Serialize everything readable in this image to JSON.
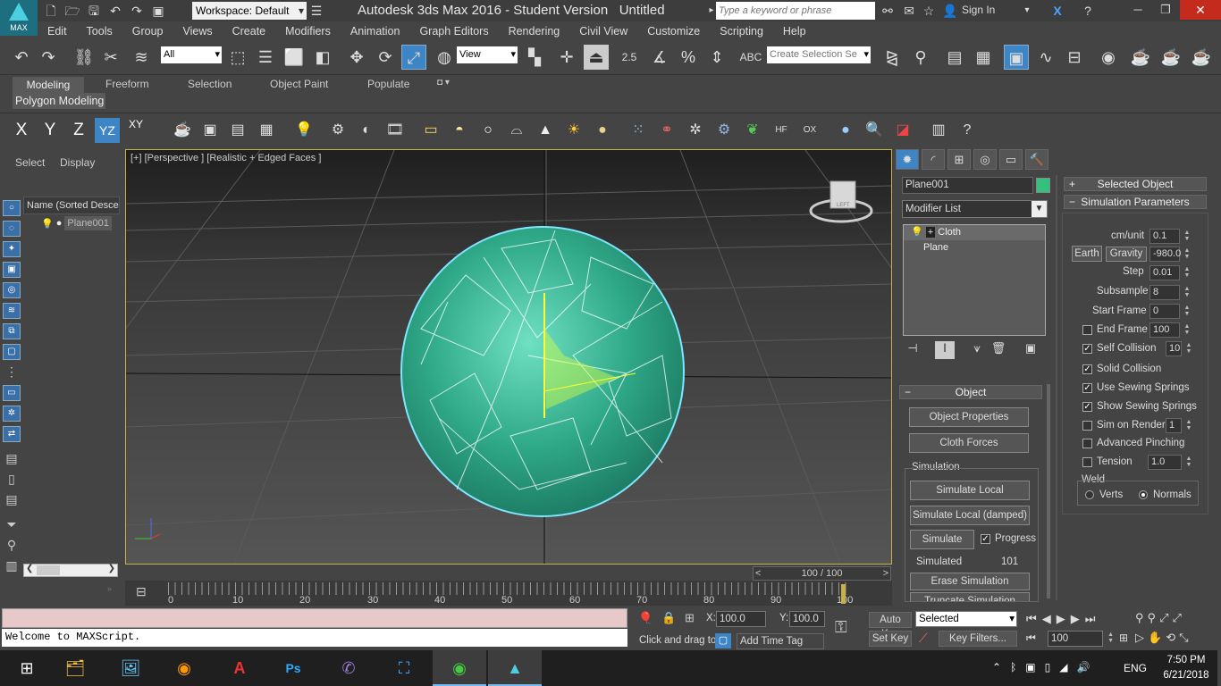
{
  "title_bar": {
    "logo_label": "MAX",
    "workspace": "Workspace: Default",
    "app_title": "Autodesk 3ds Max 2016 - Student Version",
    "doc_title": "Untitled",
    "search_placeholder": "Type a keyword or phrase",
    "sign_in": "Sign In"
  },
  "menu": [
    "Edit",
    "Tools",
    "Group",
    "Views",
    "Create",
    "Modifiers",
    "Animation",
    "Graph Editors",
    "Rendering",
    "Civil View",
    "Customize",
    "Scripting",
    "Help"
  ],
  "toolbar": {
    "filter": "All",
    "ref_coord": "View",
    "snap_value": "2.5",
    "selection_set_placeholder": "Create Selection Se"
  },
  "ribbon": {
    "tabs": [
      "Modeling",
      "Freeform",
      "Selection",
      "Object Paint",
      "Populate"
    ],
    "panel": "Polygon Modeling"
  },
  "axis": {
    "x": "X",
    "y": "Y",
    "z": "Z",
    "yz": "YZ",
    "xy": "XY"
  },
  "scene_explorer": {
    "tabs": [
      "Select",
      "Display"
    ],
    "column_header": "Name (Sorted Descen",
    "items": [
      "Plane001"
    ]
  },
  "viewport": {
    "label": "[+] [Perspective ] [Realistic + Edged Faces ]",
    "viewcube_face": "LEFT"
  },
  "timeline": {
    "frame_indicator": "100 / 100",
    "tick_labels": [
      "0",
      "10",
      "20",
      "30",
      "40",
      "50",
      "60",
      "70",
      "80",
      "90",
      "100"
    ]
  },
  "command_panel": {
    "object_name": "Plane001",
    "object_color": "#34c17e",
    "modifier_list": "Modifier List",
    "stack": [
      "Cloth",
      "Plane"
    ],
    "object_rollout": {
      "title": "Object",
      "buttons": [
        "Object Properties",
        "Cloth Forces"
      ],
      "simulation_group": "Simulation",
      "sim_local": "Simulate Local",
      "sim_local_damped": "Simulate Local (damped)",
      "simulate": "Simulate",
      "progress": "Progress",
      "simulated_label": "Simulated",
      "simulated_value": "101",
      "erase": "Erase Simulation",
      "truncate": "Truncate Simulation"
    },
    "selected_object": "Selected Object",
    "sim_params": {
      "title": "Simulation Parameters",
      "cm_unit_label": "cm/unit",
      "cm_unit": "0.1",
      "earth": "Earth",
      "gravity_label": "Gravity",
      "gravity": "-980.0",
      "step_label": "Step",
      "step": "0.01",
      "subsample_label": "Subsample",
      "subsample": "8",
      "start_frame_label": "Start Frame",
      "start_frame": "0",
      "end_frame_label": "End Frame",
      "end_frame": "100",
      "self_collision_label": "Self Collision",
      "self_collision": "10",
      "solid_collision": "Solid Collision",
      "use_sewing": "Use Sewing Springs",
      "show_sewing": "Show Sewing Springs",
      "sim_on_render_label": "Sim on Render",
      "sim_on_render": "1",
      "adv_pinching": "Advanced Pinching",
      "tension_label": "Tension",
      "tension": "1.0",
      "weld": "Weld",
      "verts": "Verts",
      "normals": "Normals"
    }
  },
  "status": {
    "maxscript": "Welcome to MAXScript.",
    "x_label": "X:",
    "x_value": "100.0",
    "y_label": "Y:",
    "y_value": "100.0",
    "prompt": "Click and drag to",
    "add_time_tag": "Add Time Tag",
    "auto_key": "Auto Key",
    "set_key": "Set Key",
    "key_mode": "Selected",
    "key_filters": "Key Filters...",
    "current_frame": "100"
  },
  "taskbar": {
    "lang": "ENG",
    "time": "7:50 PM",
    "date": "6/21/2018"
  }
}
